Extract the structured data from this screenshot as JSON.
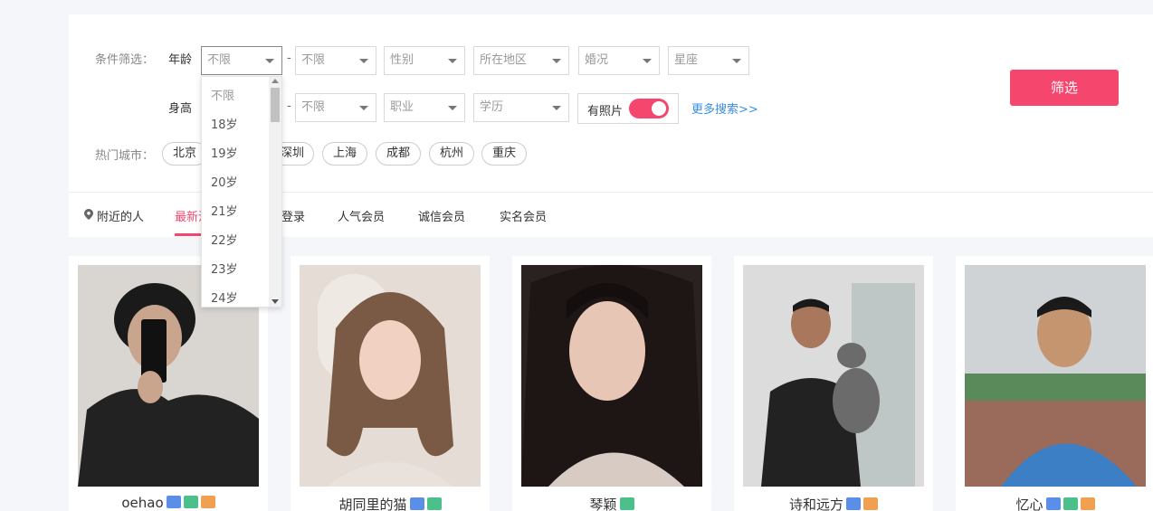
{
  "filters": {
    "label": "条件筛选：",
    "age_label": "年龄",
    "height_label": "身高",
    "age_min": "不限",
    "age_max": "不限",
    "gender": "性别",
    "region": "所在地区",
    "marital": "婚况",
    "zodiac": "星座",
    "height_max": "不限",
    "occupation": "职业",
    "education": "学历",
    "has_photo_label": "有照片",
    "has_photo_on": true,
    "more_search": "更多搜索>>",
    "dash": "-",
    "submit": "筛选"
  },
  "age_dropdown": {
    "options": [
      "不限",
      "18岁",
      "19岁",
      "20岁",
      "21岁",
      "22岁",
      "23岁",
      "24岁"
    ]
  },
  "hot_cities": {
    "label": "热门城市：",
    "cities": [
      "北京",
      "深圳",
      "上海",
      "成都",
      "杭州",
      "重庆"
    ]
  },
  "tabs": {
    "nearby": "附近的人",
    "latest": "最新注册",
    "login": "登录",
    "popular": "人气会员",
    "trusted": "诚信会员",
    "verified": "实名会员"
  },
  "members": [
    {
      "name": "oehao",
      "badges": [
        "id-card-icon",
        "phone-icon",
        "mail-icon"
      ]
    },
    {
      "name": "胡同里的猫",
      "badges": [
        "id-card-icon",
        "phone-icon"
      ]
    },
    {
      "name": "琴颖",
      "badges": [
        "phone-icon"
      ]
    },
    {
      "name": "诗和远方",
      "badges": [
        "id-card-icon",
        "mail-icon"
      ]
    },
    {
      "name": "忆心",
      "badges": [
        "id-card-icon",
        "phone-icon",
        "mail-icon"
      ]
    }
  ],
  "colors": {
    "accent": "#f5476e",
    "link": "#3a8ee6"
  }
}
